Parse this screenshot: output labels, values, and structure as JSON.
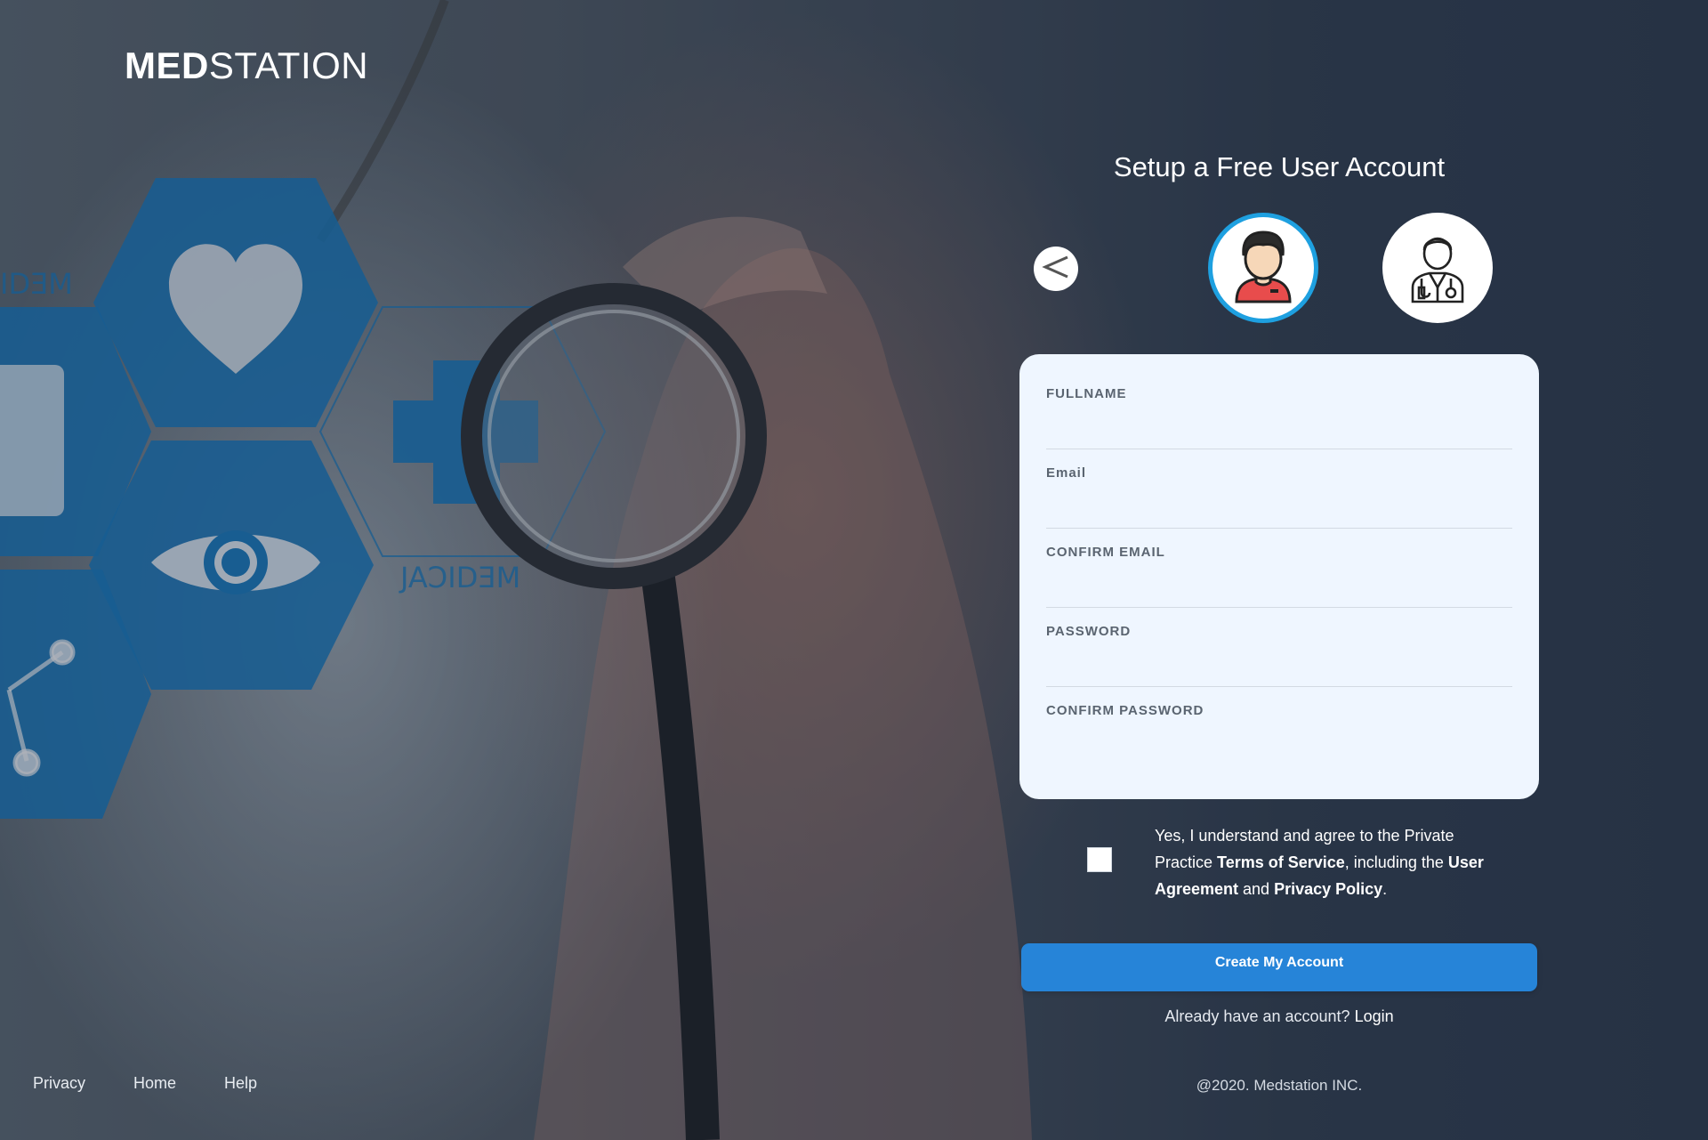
{
  "brand": {
    "bold": "MED",
    "light": "STATION"
  },
  "signup": {
    "heading": "Setup a Free User Account",
    "back_icon": "chevron-left-icon",
    "roles": [
      {
        "name": "patient",
        "icon": "patient-avatar-icon",
        "selected": true
      },
      {
        "name": "doctor",
        "icon": "doctor-avatar-icon",
        "selected": false
      }
    ],
    "fields": {
      "fullname": {
        "label": "FULLNAME",
        "value": ""
      },
      "email": {
        "label": "Email",
        "value": ""
      },
      "confirm_email": {
        "label": "CONFIRM EMAIL",
        "value": ""
      },
      "password": {
        "label": "PASSWORD",
        "value": ""
      },
      "confirm_password": {
        "label": "CONFIRM PASSWORD",
        "value": ""
      }
    },
    "agreement": {
      "checked": false,
      "text_1": "Yes, I understand and agree to the Private Practice ",
      "terms": "Terms of Service",
      "text_2": ", including the ",
      "user_agreement": "User Agreement",
      "text_3": " and ",
      "privacy_policy": "Privacy Policy",
      "text_4": "."
    },
    "create_button": "Create My Account",
    "login_prompt": "Already have an account?",
    "login_link": "Login"
  },
  "footer": {
    "links": [
      "Privacy",
      "Home",
      "Help"
    ],
    "copyright": "@2020. Medstation INC."
  },
  "colors": {
    "accent": "#2684d8",
    "selected_ring": "#1ea0e0",
    "card_bg": "#eff6ff",
    "hex_blue": "#1870b0"
  }
}
